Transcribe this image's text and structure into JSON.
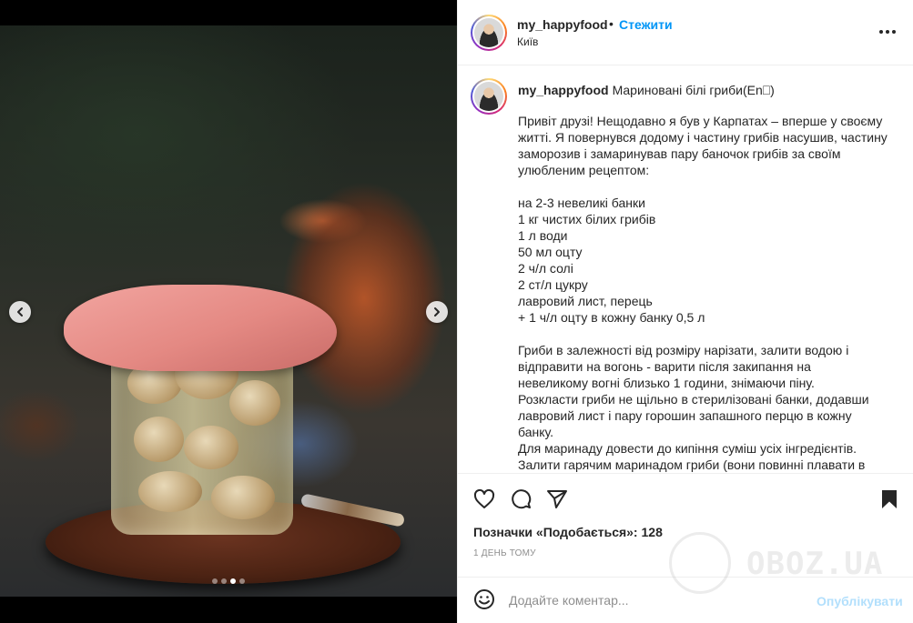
{
  "post": {
    "username": "my_happyfood",
    "separator": "•",
    "follow_label": "Стежити",
    "location": "Київ"
  },
  "caption": {
    "username": "my_happyfood",
    "title": "Мариновані білі гриби(En⎕)",
    "lines": [
      "Привіт друзі! Нещодавно я був у Карпатах – вперше у своєму",
      "житті. Я повернувся додому і частину грибів насушив, частину",
      "заморозив і замаринував пару баночок грибів за своїм",
      "улюбленим рецептом:",
      "",
      "на 2-3 невеликі банки",
      "1 кг чистих білих грибів",
      "1 л води",
      "50 мл оцту",
      "2 ч/л солі",
      "2 ст/л цукру",
      "лавровий лист, перець",
      "+ 1 ч/л оцту в кожну банку 0,5 л",
      "",
      "Гриби в залежності від розміру нарізати, залити водою і",
      "відправити на вогонь - варити після закипання на",
      "невеликому вогні близько 1 години, знімаючи піну.",
      "Розкласти гриби не щільно в стерилізовані банки, додавши",
      "лавровий лист і пару горошин запашного перцю в кожну",
      "банку.",
      "Для маринаду довести до кипіння суміш усіх інгредієнтів.",
      "Залити гарячим маринадом гриби (вони повинні плавати в"
    ]
  },
  "stats": {
    "likes_label": "Позначки «Подобається»:",
    "likes_count": "128",
    "time_ago": "1 ДЕНЬ ТОМУ"
  },
  "comment": {
    "placeholder": "Додайте коментар...",
    "publish_label": "Опублікувати"
  },
  "carousel": {
    "total": 4,
    "active_index": 2
  },
  "watermark": {
    "text": "OBOZ.UA"
  },
  "icons": {
    "like": "heart-icon",
    "comment": "comment-icon",
    "share": "paper-plane-icon",
    "save": "bookmark-icon",
    "emoji": "smiley-icon",
    "more": "more-horizontal-icon",
    "prev": "chevron-left-icon",
    "next": "chevron-right-icon"
  },
  "colors": {
    "accent": "#0095f6",
    "publish_disabled": "#b2dffc",
    "muted": "#8e8e8e",
    "text": "#262626"
  }
}
